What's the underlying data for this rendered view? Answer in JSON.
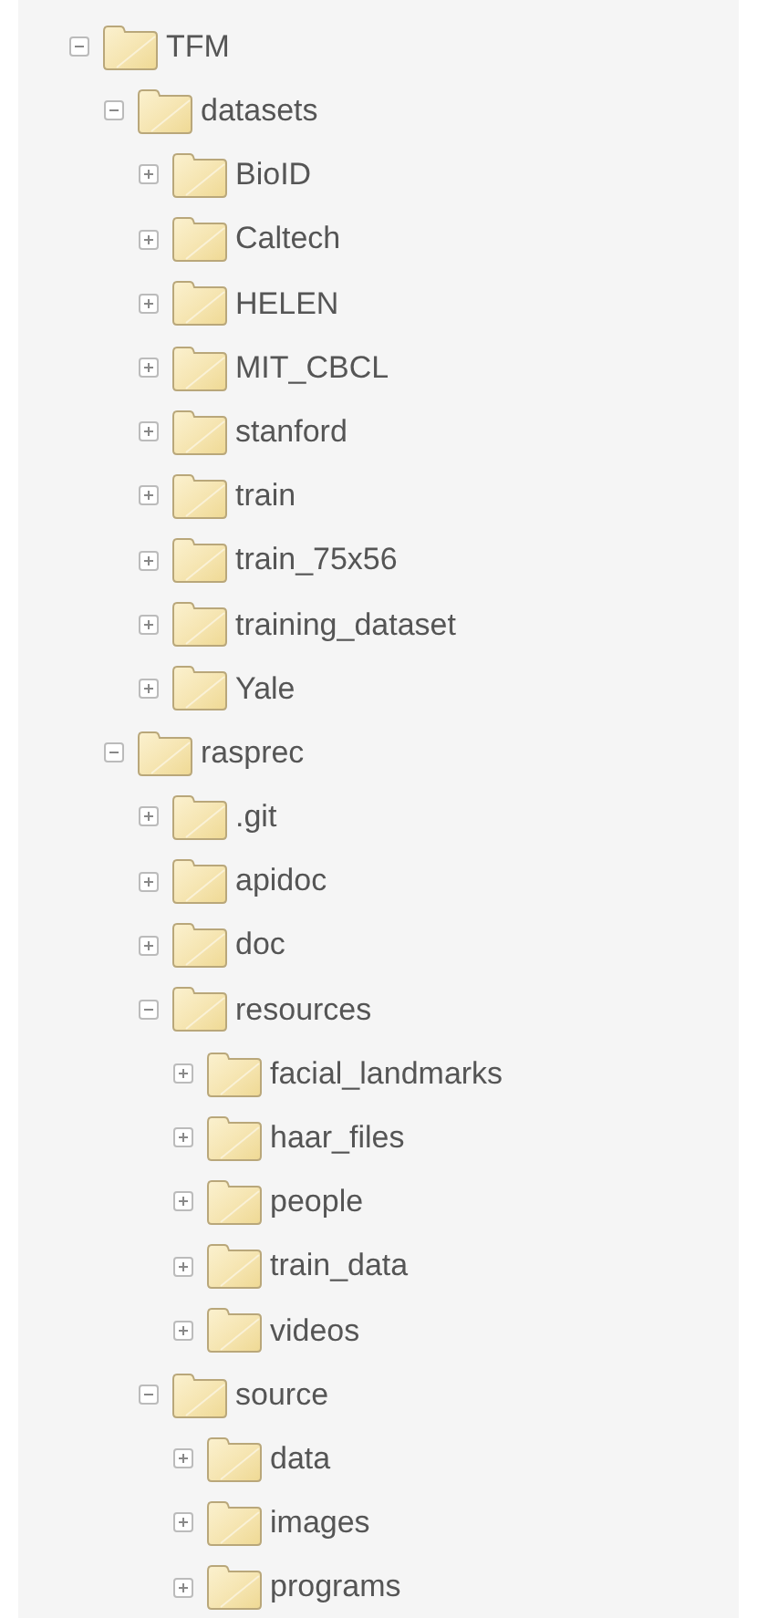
{
  "tree": [
    {
      "label": "TFM",
      "expanded": true,
      "children": [
        {
          "label": "datasets",
          "expanded": true,
          "children": [
            {
              "label": "BioID",
              "expanded": false
            },
            {
              "label": "Caltech",
              "expanded": false
            },
            {
              "label": "HELEN",
              "expanded": false
            },
            {
              "label": "MIT_CBCL",
              "expanded": false
            },
            {
              "label": "stanford",
              "expanded": false
            },
            {
              "label": "train",
              "expanded": false
            },
            {
              "label": "train_75x56",
              "expanded": false
            },
            {
              "label": "training_dataset",
              "expanded": false
            },
            {
              "label": "Yale",
              "expanded": false
            }
          ]
        },
        {
          "label": "rasprec",
          "expanded": true,
          "children": [
            {
              "label": ".git",
              "expanded": false
            },
            {
              "label": "apidoc",
              "expanded": false
            },
            {
              "label": "doc",
              "expanded": false
            },
            {
              "label": "resources",
              "expanded": true,
              "children": [
                {
                  "label": "facial_landmarks",
                  "expanded": false
                },
                {
                  "label": "haar_files",
                  "expanded": false
                },
                {
                  "label": "people",
                  "expanded": false
                },
                {
                  "label": "train_data",
                  "expanded": false
                },
                {
                  "label": "videos",
                  "expanded": false
                }
              ]
            },
            {
              "label": "source",
              "expanded": true,
              "children": [
                {
                  "label": "data",
                  "expanded": false
                },
                {
                  "label": "images",
                  "expanded": false
                },
                {
                  "label": "programs",
                  "expanded": false
                }
              ]
            }
          ]
        }
      ]
    }
  ]
}
